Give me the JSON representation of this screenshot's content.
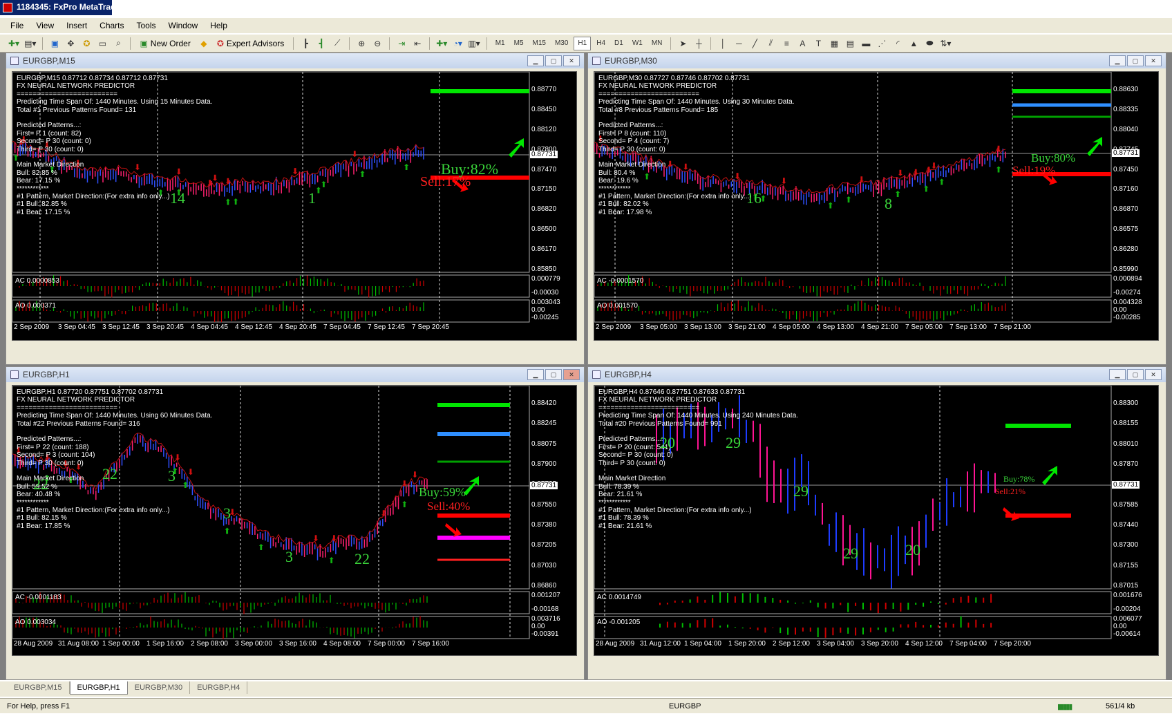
{
  "app": {
    "title": "1184345: FxPro MetaTrad"
  },
  "menu": [
    "File",
    "View",
    "Insert",
    "Charts",
    "Tools",
    "Window",
    "Help"
  ],
  "toolbar": {
    "new_order": "New Order",
    "expert_advisors": "Expert Advisors",
    "timeframes": [
      "M1",
      "M5",
      "M15",
      "M30",
      "H1",
      "H4",
      "D1",
      "W1",
      "MN"
    ],
    "active_tf": "H1"
  },
  "charts": [
    {
      "title": "EURGBP,M15",
      "info": [
        "EURGBP,M15  0.87712 0.87734 0.87712 0.87731",
        "FX NEURAL NETWORK PREDICTOR",
        "=========================",
        "Predicting Time Span Of: 1440 Minutes. Using 15 Minutes Data.",
        "Total #1 Previous Patterns Found= 131",
        "",
        "Predicted Patterns...:",
        "First= P 1  (count: 82)",
        "Second= P 30  (count: 0)",
        "Third= P 30  (count: 0)",
        "",
        "Main Market Direction",
        "Bull: 82.85 %",
        "Bear: 17.15 %",
        "************",
        "#1 Pattern, Market Direction:(For extra info only...)",
        "#1 Bull: 82.85 %",
        "#1 Bear: 17.15 %"
      ],
      "buy": "Buy:82%",
      "sell": "Sell:17%",
      "pattern_numbers": [
        "14",
        "1"
      ],
      "prices": [
        "0.88770",
        "0.88450",
        "0.88120",
        "0.87800",
        "0.87470",
        "0.87150",
        "0.86820",
        "0.86500",
        "0.86170",
        "0.85850"
      ],
      "current_price": "0.87731",
      "ac": {
        "label": "AC 0.0000853",
        "scale": [
          "0.000779",
          "-0.00030"
        ]
      },
      "ao": {
        "label": "AO 0.000371",
        "scale": [
          "0.003043",
          "0.00",
          "-0.00245"
        ]
      },
      "dates": [
        "2 Sep 2009",
        "3 Sep 04:45",
        "3 Sep 12:45",
        "3 Sep 20:45",
        "4 Sep 04:45",
        "4 Sep 12:45",
        "4 Sep 20:45",
        "7 Sep 04:45",
        "7 Sep 12:45",
        "7 Sep 20:45"
      ]
    },
    {
      "title": "EURGBP,M30",
      "info": [
        "EURGBP,M30  0.87727 0.87746 0.87702 0.87731",
        "FX NEURAL NETWORK PREDICTOR",
        "=========================",
        "Predicting Time Span Of: 1440 Minutes. Using 30 Minutes Data.",
        "Total #8 Previous Patterns Found= 185",
        "",
        "Predicted Patterns...:",
        "First= P 8  (count: 110)",
        "Second= P 4  (count: 7)",
        "Third= P 30  (count: 0)",
        "",
        "Main Market Direction",
        "Bull: 80.4 %",
        "Bear: 19.6 %",
        "************",
        "#1 Pattern, Market Direction:(For extra info only...)",
        "#1 Bull: 82.02 %",
        "#1 Bear: 17.98 %"
      ],
      "buy": "Buy:80%",
      "sell": "Sell:19%",
      "pattern_numbers": [
        "16",
        "8"
      ],
      "prices": [
        "0.88630",
        "0.88335",
        "0.88040",
        "0.87745",
        "0.87450",
        "0.87160",
        "0.86870",
        "0.86575",
        "0.86280",
        "0.85990"
      ],
      "current_price": "0.87731",
      "ac": {
        "label": "AC -0.0001570",
        "scale": [
          "0.000894",
          "-0.00274"
        ]
      },
      "ao": {
        "label": "AO 0.001570",
        "scale": [
          "0.004328",
          "0.00",
          "-0.00285"
        ]
      },
      "dates": [
        "2 Sep 2009",
        "3 Sep 05:00",
        "3 Sep 13:00",
        "3 Sep 21:00",
        "4 Sep 05:00",
        "4 Sep 13:00",
        "4 Sep 21:00",
        "7 Sep 05:00",
        "7 Sep 13:00",
        "7 Sep 21:00"
      ]
    },
    {
      "title": "EURGBP,H1",
      "info": [
        "EURGBP,H1  0.87720 0.87751 0.87702 0.87731",
        "FX NEURAL NETWORK PREDICTOR",
        "=========================",
        "Predicting Time Span Of: 1440 Minutes. Using 60 Minutes Data.",
        "Total #22 Previous Patterns Found= 316",
        "",
        "Predicted Patterns...:",
        "First= P 22  (count: 188)",
        "Second= P 3  (count: 104)",
        "Third= P 30  (count: 0)",
        "",
        "Main Market Direction",
        "Bull: 59.52 %",
        "Bear: 40.48 %",
        "************",
        "#1 Pattern, Market Direction:(For extra info only...)",
        "#1 Bull: 82.15 %",
        "#1 Bear: 17.85 %"
      ],
      "buy": "Buy:59%",
      "sell": "Sell:40%",
      "pattern_numbers": [
        "22",
        "22",
        "3",
        "3",
        "3",
        "22"
      ],
      "prices": [
        "0.88420",
        "0.88245",
        "0.88075",
        "0.87900",
        "0.87725",
        "0.87550",
        "0.87380",
        "0.87205",
        "0.87030",
        "0.86860"
      ],
      "current_price": "0.87731",
      "ac": {
        "label": "AC -0.0001183",
        "scale": [
          "0.001207",
          "-0.00168"
        ]
      },
      "ao": {
        "label": "AO 0.003034",
        "scale": [
          "0.003716",
          "0.00",
          "-0.00391"
        ]
      },
      "dates": [
        "28 Aug 2009",
        "31 Aug 08:00",
        "1 Sep 00:00",
        "1 Sep 16:00",
        "2 Sep 08:00",
        "3 Sep 00:00",
        "3 Sep 16:00",
        "4 Sep 08:00",
        "7 Sep 00:00",
        "7 Sep 16:00"
      ]
    },
    {
      "title": "EURGBP,H4",
      "info": [
        "EURGBP,H4  0.87646 0.87751 0.87633 0.87731",
        "FX NEURAL NETWORK PREDICTOR",
        "=========================",
        "Predicting Time Span Of: 1440 Minutes. Using 240 Minutes Data.",
        "Total #20 Previous Patterns Found= 991",
        "",
        "Predicted Patterns...:",
        "First= P 20  (count: 541)",
        "Second= P 30  (count: 0)",
        "Third= P 30  (count: 0)",
        "",
        "Main Market Direction",
        "Bull: 78.39 %",
        "Bear: 21.61 %",
        "************",
        "#1 Pattern, Market Direction:(For extra info only...)",
        "#1 Bull: 78.39 %",
        "#1 Bear: 21.61 %"
      ],
      "buy": "Buy:78%",
      "sell": "Sell:21%",
      "pattern_numbers": [
        "20",
        "29",
        "29",
        "29",
        "20"
      ],
      "prices": [
        "0.88300",
        "0.88155",
        "0.88010",
        "0.87870",
        "0.87725",
        "0.87585",
        "0.87440",
        "0.87300",
        "0.87155",
        "0.87015"
      ],
      "current_price": "0.87731",
      "ac": {
        "label": "AC 0.0014749",
        "scale": [
          "0.001676",
          "-0.00204"
        ]
      },
      "ao": {
        "label": "AO -0.001205",
        "scale": [
          "0.006077",
          "0.00",
          "-0.00614"
        ]
      },
      "dates": [
        "28 Aug 2009",
        "31 Aug 12:00",
        "1 Sep 04:00",
        "1 Sep 20:00",
        "2 Sep 12:00",
        "3 Sep 04:00",
        "3 Sep 20:00",
        "4 Sep 12:00",
        "7 Sep 04:00",
        "7 Sep 20:00"
      ]
    }
  ],
  "tabs": [
    "EURGBP,M15",
    "EURGBP,H1",
    "EURGBP,M30",
    "EURGBP,H4"
  ],
  "active_tab": "EURGBP,H1",
  "status": {
    "help": "For Help, press F1",
    "symbol": "EURGBP",
    "traffic": "561/4 kb"
  }
}
